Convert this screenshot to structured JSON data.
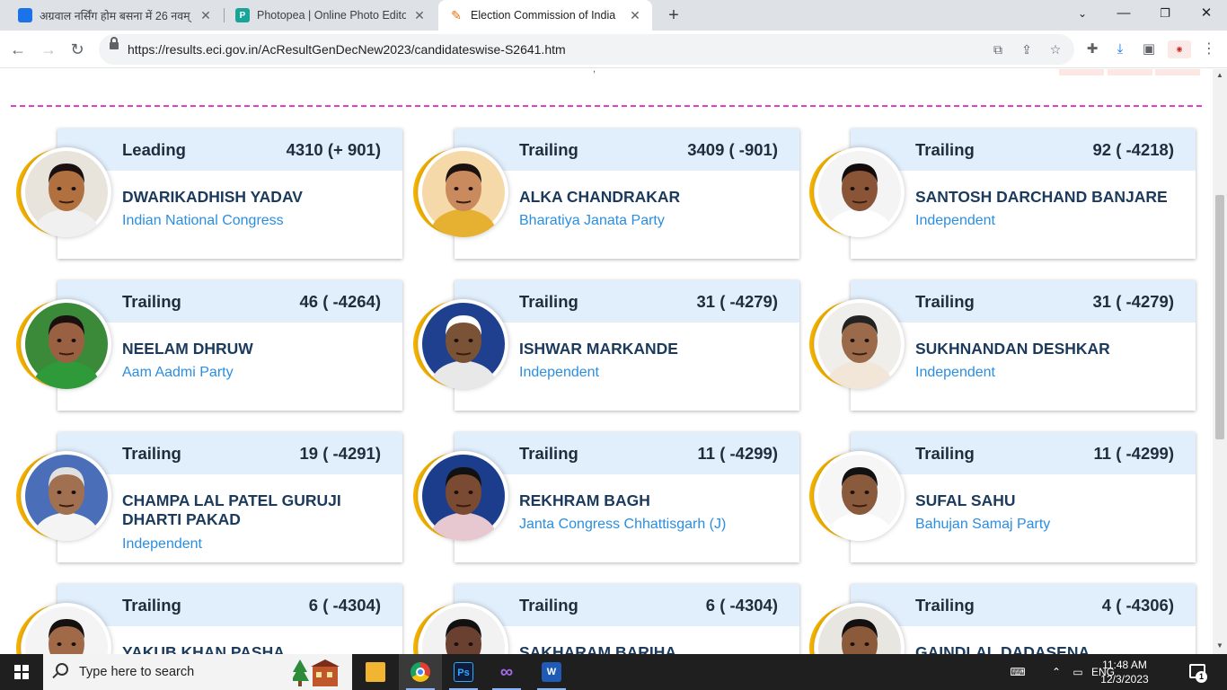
{
  "browser": {
    "tabs": [
      {
        "title": "अग्रवाल नर्सिंग होम बसना में 26 नवम्",
        "favicon": "blue-cube-icon",
        "color": "#1a73e8"
      },
      {
        "title": "Photopea | Online Photo Editor",
        "favicon": "photopea-icon",
        "color": "#18a497"
      },
      {
        "title": "Election Commission of India",
        "favicon": "eci-icon",
        "color": "#e8710a"
      }
    ],
    "url": "https://results.eci.gov.in/AcResultGenDecNew2023/candidateswise-S2641.htm"
  },
  "candidates": [
    {
      "status": "Leading",
      "votes": "4310 (+ 901)",
      "name": "DWARIKADHISH YADAV",
      "party": "Indian National Congress",
      "photo_bg": "#e8e4dc",
      "skin": "#b0703f",
      "shirt": "#f0f0f0",
      "hair": "#1a1010"
    },
    {
      "status": "Trailing",
      "votes": "3409 ( -901)",
      "name": "ALKA CHANDRAKAR",
      "party": "Bharatiya Janata Party",
      "photo_bg": "#f5d9a8",
      "skin": "#c98a5e",
      "shirt": "#e6b030",
      "hair": "#1c1111"
    },
    {
      "status": "Trailing",
      "votes": "92 ( -4218)",
      "name": "SANTOSH DARCHAND BANJARE",
      "party": "Independent",
      "photo_bg": "#f4f4f4",
      "skin": "#8a5536",
      "shirt": "#ffffff",
      "hair": "#120c0c"
    },
    {
      "status": "Trailing",
      "votes": "46 ( -4264)",
      "name": "NEELAM DHRUW",
      "party": "Aam Aadmi Party",
      "photo_bg": "#3a8a3a",
      "skin": "#9a6042",
      "shirt": "#2f9a3a",
      "hair": "#1a1010"
    },
    {
      "status": "Trailing",
      "votes": "31 ( -4279)",
      "name": "ISHWAR MARKANDE",
      "party": "Independent",
      "photo_bg": "#1f3f8f",
      "skin": "#7a5236",
      "shirt": "#e8e8e8",
      "hair": "#ffffff"
    },
    {
      "status": "Trailing",
      "votes": "31 ( -4279)",
      "name": "SUKHNANDAN DESHKAR",
      "party": "Independent",
      "photo_bg": "#f0eeea",
      "skin": "#9a6a4a",
      "shirt": "#f2e6d8",
      "hair": "#222222"
    },
    {
      "status": "Trailing",
      "votes": "19 ( -4291)",
      "name": "CHAMPA LAL PATEL GURUJI DHARTI PAKAD",
      "party": "Independent",
      "photo_bg": "#4a6fb8",
      "skin": "#a07050",
      "shirt": "#f4f4f4",
      "hair": "#e0e0e0"
    },
    {
      "status": "Trailing",
      "votes": "11 ( -4299)",
      "name": "REKHRAM BAGH",
      "party": "Janta Congress Chhattisgarh (J)",
      "photo_bg": "#1c3d8c",
      "skin": "#7a4a32",
      "shirt": "#e8c8d0",
      "hair": "#111111"
    },
    {
      "status": "Trailing",
      "votes": "11 ( -4299)",
      "name": "SUFAL SAHU",
      "party": "Bahujan Samaj Party",
      "photo_bg": "#f6f6f6",
      "skin": "#8a5a3c",
      "shirt": "#ffffff",
      "hair": "#111111"
    },
    {
      "status": "Trailing",
      "votes": "6 ( -4304)",
      "name": "YAKUB KHAN PASHA",
      "party": "",
      "photo_bg": "#f4f4f4",
      "skin": "#a06a48",
      "shirt": "#f0f0f0",
      "hair": "#151010"
    },
    {
      "status": "Trailing",
      "votes": "6 ( -4304)",
      "name": "SAKHARAM BARIHA",
      "party": "",
      "photo_bg": "#f2f2f2",
      "skin": "#6a4030",
      "shirt": "#d8d8d8",
      "hair": "#111111"
    },
    {
      "status": "Trailing",
      "votes": "4 ( -4306)",
      "name": "GAINDLAL DADASENA",
      "party": "",
      "photo_bg": "#e8e6e0",
      "skin": "#8a5a3a",
      "shirt": "#e0e0e0",
      "hair": "#151010"
    }
  ],
  "taskbar": {
    "search_placeholder": "Type here to search",
    "language": "ENG",
    "time": "11:48 AM",
    "date": "12/3/2023",
    "notification_count": "1",
    "apps": [
      {
        "name": "file-explorer-icon",
        "color": "#f2b531",
        "label": ""
      },
      {
        "name": "chrome-icon",
        "color": "#de4032",
        "label": ""
      },
      {
        "name": "photoshop-icon",
        "color": "#0f1d3c",
        "label": "Ps"
      },
      {
        "name": "visual-studio-icon",
        "color": "#6b2fa0",
        "label": ""
      },
      {
        "name": "word-icon",
        "color": "#1f5bb6",
        "label": "W"
      }
    ]
  }
}
